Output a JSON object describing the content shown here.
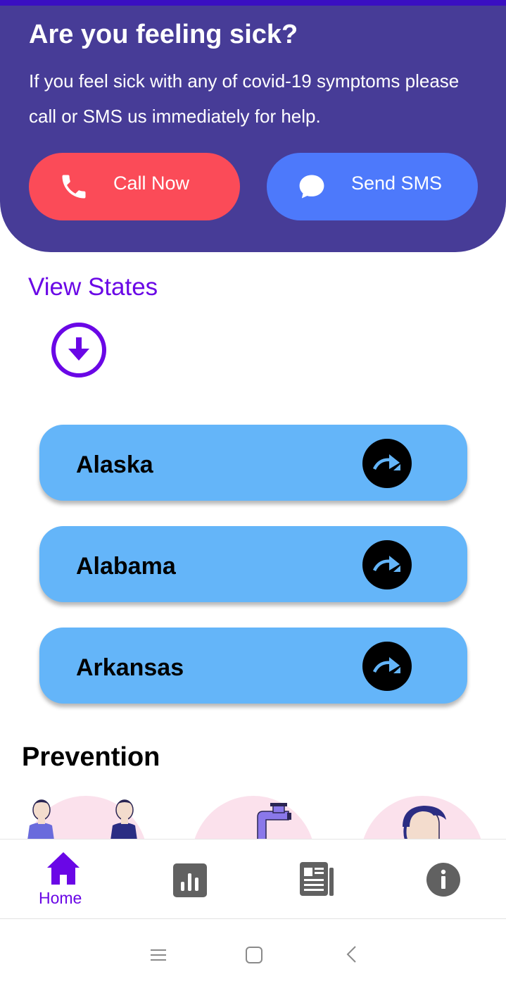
{
  "hero": {
    "title": "Are you feeling sick?",
    "description": "If you feel sick with any of covid-19 symptoms please call or SMS us immediately for help.",
    "call_label": "Call Now",
    "sms_label": "Send SMS"
  },
  "states_section": {
    "link_label": "View States",
    "expand_icon": "arrow-down-circle-icon",
    "items": [
      {
        "name": "Alaska",
        "icon": "share-forward-icon"
      },
      {
        "name": "Alabama",
        "icon": "share-forward-icon"
      },
      {
        "name": "Arkansas",
        "icon": "share-forward-icon"
      }
    ]
  },
  "prevention": {
    "title": "Prevention",
    "cards": [
      "avoid-contact-illustration",
      "wash-hands-illustration",
      "wear-mask-illustration"
    ]
  },
  "bottom_nav": {
    "items": [
      {
        "label": "Home",
        "icon": "home-icon",
        "active": true
      },
      {
        "label": "",
        "icon": "stats-icon",
        "active": false
      },
      {
        "label": "",
        "icon": "news-icon",
        "active": false
      },
      {
        "label": "",
        "icon": "info-icon",
        "active": false
      }
    ]
  },
  "colors": {
    "accent": "#6a07e6",
    "hero_bg": "#473c97",
    "call_btn": "#fb4b58",
    "sms_btn": "#4d79fb",
    "state_card": "#64b5f9"
  }
}
